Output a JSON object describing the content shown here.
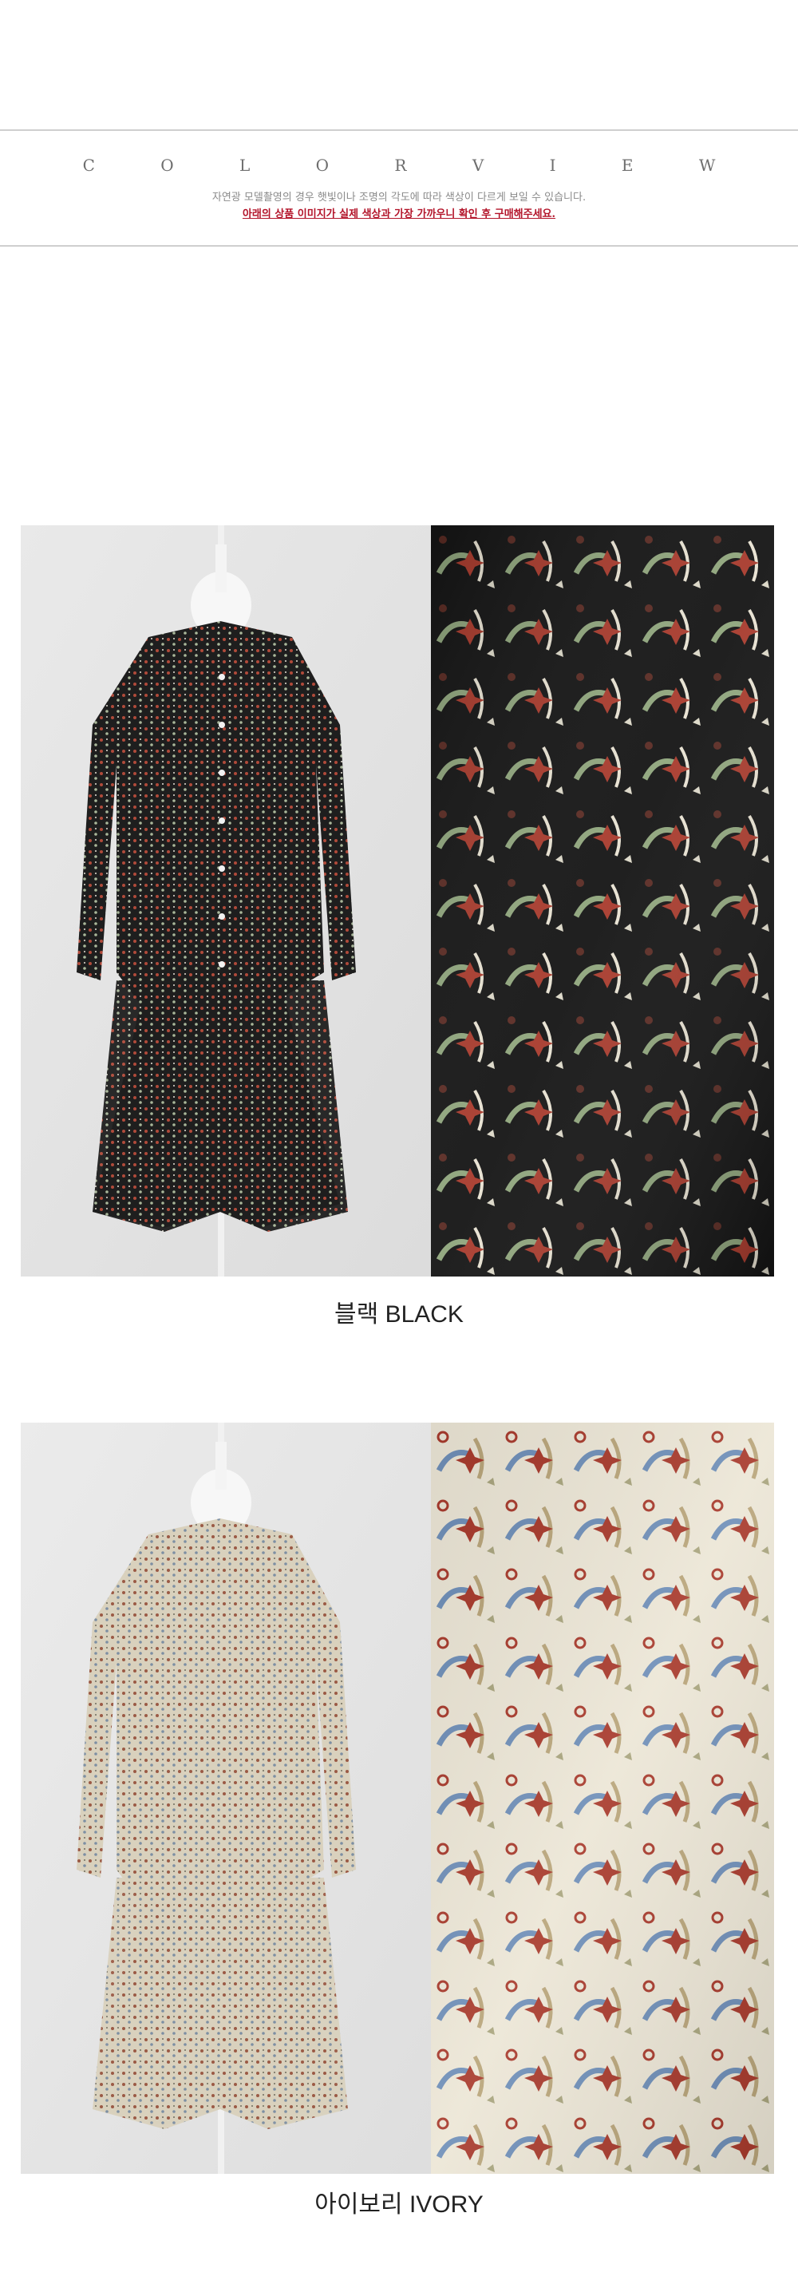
{
  "header": {
    "title": "C O L O R  V I E W",
    "note_1": "자연광 모델촬영의 경우 햇빛이나 조명의 각도에 따라 색상이 다르게 보일 수 있습니다.",
    "note_2": "아래의 상품 이미지가 실제 색상과 가장 가까우니 확인 후 구매해주세요."
  },
  "colors": [
    {
      "caption": "블랙 BLACK",
      "fabric_bg": "#141414",
      "accent": "#a83a2c",
      "leaf": "#8fa57c"
    },
    {
      "caption": "아이보리 IVORY",
      "fabric_bg": "#ece6d6",
      "accent": "#a83a2c",
      "leaf": "#6f8fb8"
    }
  ]
}
